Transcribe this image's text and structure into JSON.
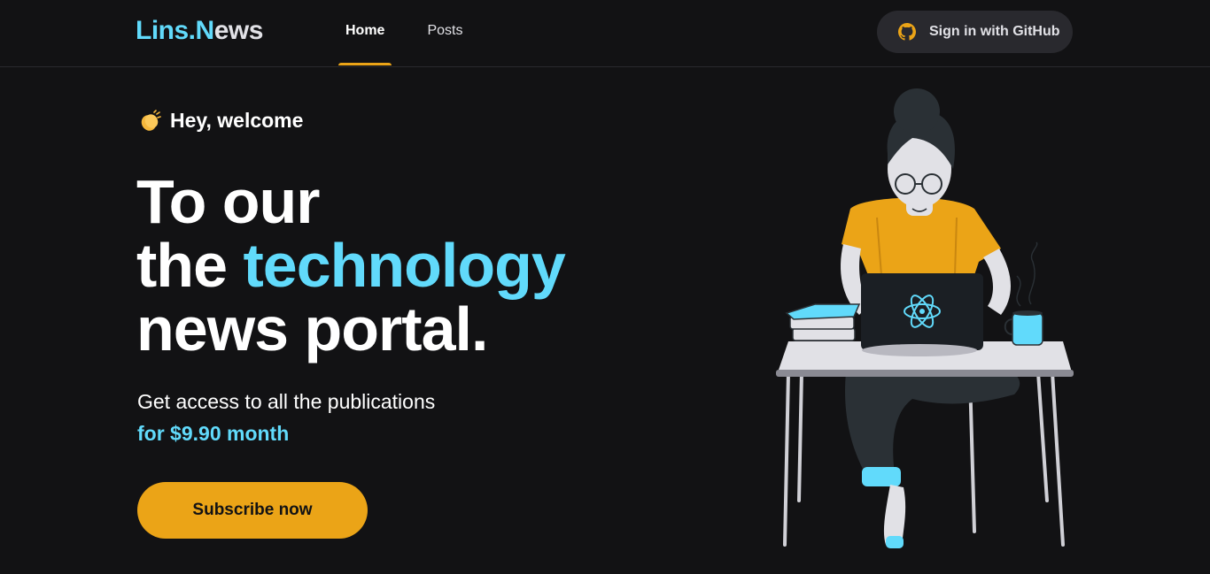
{
  "header": {
    "logo_main": "Lins",
    "logo_dot": ".",
    "logo_accent": "N",
    "logo_rest": "ews",
    "nav": [
      {
        "label": "Home",
        "active": true
      },
      {
        "label": "Posts",
        "active": false
      }
    ],
    "signin_label": "Sign in with GitHub",
    "signin_icon": "github-icon"
  },
  "hero": {
    "welcome_icon": "clapping-hands-icon",
    "welcome": "Hey, welcome",
    "headline_line1": "To our",
    "headline_line2_a": "the ",
    "headline_line2_b": "technology",
    "headline_line3": "news portal.",
    "sub_line1": "Get access to all the publications",
    "sub_price": "for $9.90 month",
    "cta": "Subscribe now"
  },
  "colors": {
    "background": "#121214",
    "accent_blue": "#61dafb",
    "accent_yellow": "#eba417",
    "surface": "#29292e"
  }
}
